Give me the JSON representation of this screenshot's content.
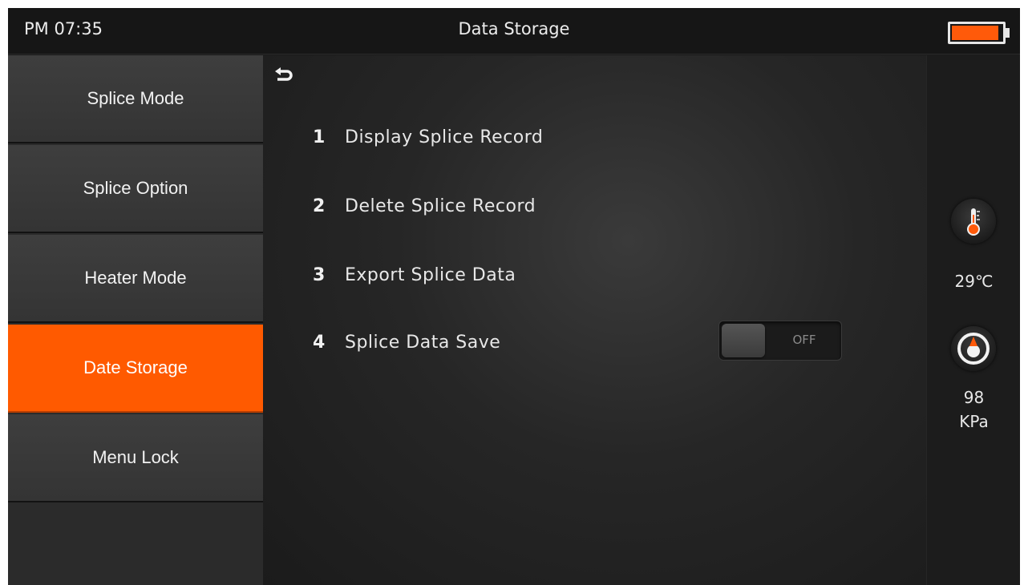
{
  "header": {
    "time": "PM 07:35",
    "title": "Data Storage",
    "battery_color": "#ff5a0a"
  },
  "sidebar": {
    "items": [
      {
        "label": "Splice Mode",
        "active": false
      },
      {
        "label": "Splice Option",
        "active": false
      },
      {
        "label": "Heater Mode",
        "active": false
      },
      {
        "label": "Date Storage",
        "active": true
      },
      {
        "label": "Menu Lock",
        "active": false
      }
    ],
    "accent_color": "#ff5a00"
  },
  "main": {
    "back_icon": "return-arrow-icon",
    "options": [
      {
        "number": "1",
        "label": "Display Splice Record"
      },
      {
        "number": "2",
        "label": "Delete Splice Record"
      },
      {
        "number": "3",
        "label": "Export Splice Data"
      },
      {
        "number": "4",
        "label": "Splice Data Save"
      }
    ],
    "toggle": {
      "state_label": "OFF",
      "on": false
    }
  },
  "status": {
    "temperature": "29℃",
    "pressure_value": "98",
    "pressure_unit": "KPa",
    "temperature_icon": "thermometer-icon",
    "pressure_icon": "pressure-gauge-icon"
  }
}
